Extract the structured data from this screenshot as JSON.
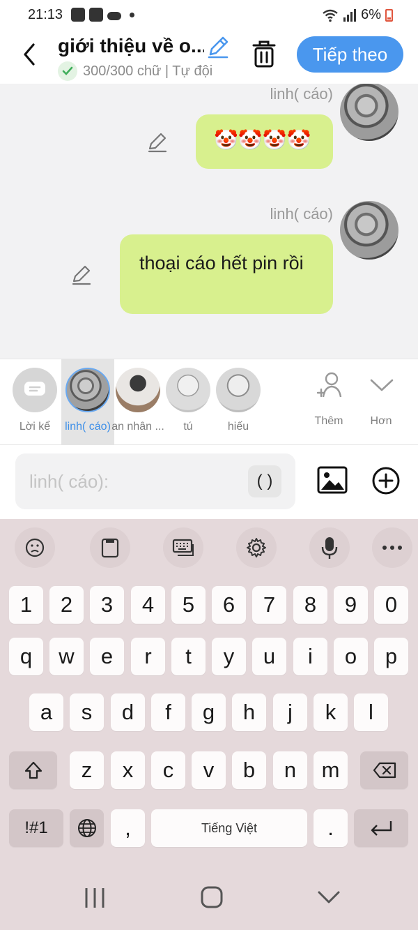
{
  "status": {
    "time": "21:13",
    "battery": "6%"
  },
  "header": {
    "title": "giới thiệu về o...",
    "subtitle": "300/300 chữ | Tự đội",
    "next_label": "Tiếp theo"
  },
  "messages": [
    {
      "sender": "linh( cáo)",
      "text": "🤡🤡🤡🤡"
    },
    {
      "sender": "linh( cáo)",
      "text": "thoại cáo hết pin rồi"
    }
  ],
  "mentions": [
    {
      "label": "Lời kể"
    },
    {
      "label": "linh( cáo)"
    },
    {
      "label": "an nhân ..."
    },
    {
      "label": "tú"
    },
    {
      "label": "hiếu"
    }
  ],
  "actions": {
    "add_label": "Thêm",
    "more_label": "Hơn"
  },
  "input": {
    "placeholder": "linh( cáo):",
    "paren_label": "( )"
  },
  "keyboard": {
    "numbers": [
      "1",
      "2",
      "3",
      "4",
      "5",
      "6",
      "7",
      "8",
      "9",
      "0"
    ],
    "row1": [
      "q",
      "w",
      "e",
      "r",
      "t",
      "y",
      "u",
      "i",
      "o",
      "p"
    ],
    "row2": [
      "a",
      "s",
      "d",
      "f",
      "g",
      "h",
      "j",
      "k",
      "l"
    ],
    "row3": [
      "z",
      "x",
      "c",
      "v",
      "b",
      "n",
      "m"
    ],
    "symbols_label": "!#1",
    "comma": ",",
    "space_label": "Tiếng Việt",
    "period": "."
  },
  "colors": {
    "accent": "#4a97ee",
    "bubble": "#d8f08e",
    "keyboard_bg": "#e5d9db"
  }
}
